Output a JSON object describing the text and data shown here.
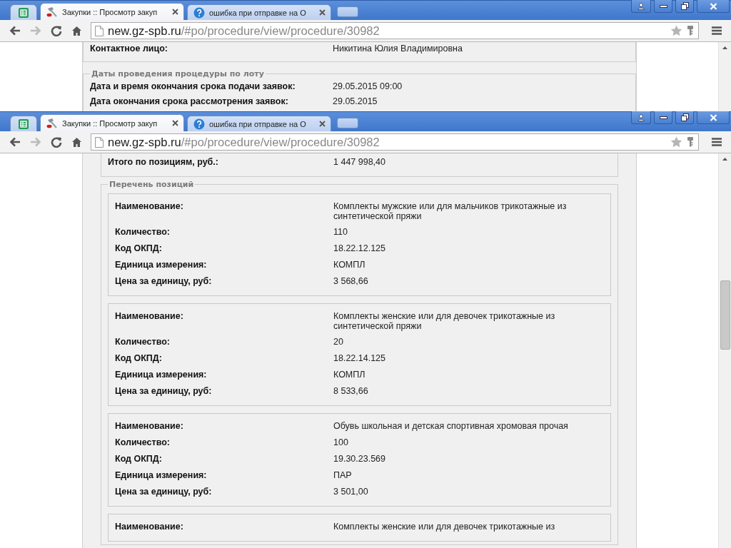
{
  "windows": [
    {
      "tabs": [
        {
          "kind": "app",
          "selected": false
        },
        {
          "kind": "page",
          "title": "Закупки :: Просмотр закуп",
          "selected": true
        },
        {
          "kind": "page",
          "title": "ошибка при отправке на О",
          "selected": false
        },
        {
          "kind": "new"
        }
      ],
      "address": {
        "host": "new.gz-spb.ru",
        "path": "/#po/procedure/view/procedure/30982"
      },
      "sections": [
        {
          "kind": "plain",
          "rows": [
            {
              "label": "Контактное лицо:",
              "value": "Никитина Юлия Владимировна"
            }
          ]
        },
        {
          "kind": "fieldset",
          "legend": "Даты проведения процедуры по лоту",
          "rows": [
            {
              "label": "Дата и время окончания срока подачи заявок:",
              "value": "29.05.2015 09:00"
            },
            {
              "label": "Дата окончания срока рассмотрения заявок:",
              "value": "29.05.2015"
            }
          ]
        }
      ]
    },
    {
      "tabs": [
        {
          "kind": "app",
          "selected": false
        },
        {
          "kind": "page",
          "title": "Закупки :: Просмотр закуп",
          "selected": true
        },
        {
          "kind": "page",
          "title": "ошибка при отправке на О",
          "selected": false
        },
        {
          "kind": "new"
        }
      ],
      "address": {
        "host": "new.gz-spb.ru",
        "path": "/#po/procedure/view/procedure/30982"
      },
      "sections": [
        {
          "kind": "plain",
          "rows": [
            {
              "label": "Итого по позициям, руб.:",
              "value": "1 447 998,40"
            }
          ]
        },
        {
          "kind": "fieldset",
          "legend": "Перечень позиций",
          "items": [
            {
              "rows": [
                {
                  "label": "Наименование:",
                  "value": "Комплекты мужские или для мальчиков трикотажные из синтетической пряжи"
                },
                {
                  "label": "Количество:",
                  "value": "110"
                },
                {
                  "label": "Код ОКПД:",
                  "value": "18.22.12.125"
                },
                {
                  "label": "Единица измерения:",
                  "value": "КОМПЛ"
                },
                {
                  "label": "Цена за единицу, руб:",
                  "value": "3 568,66"
                }
              ]
            },
            {
              "rows": [
                {
                  "label": "Наименование:",
                  "value": "Комплекты женские или для девочек трикотажные из синтетической пряжи"
                },
                {
                  "label": "Количество:",
                  "value": "20"
                },
                {
                  "label": "Код ОКПД:",
                  "value": "18.22.14.125"
                },
                {
                  "label": "Единица измерения:",
                  "value": "КОМПЛ"
                },
                {
                  "label": "Цена за единицу, руб:",
                  "value": "8 533,66"
                }
              ]
            },
            {
              "rows": [
                {
                  "label": "Наименование:",
                  "value": "Обувь школьная и детская спортивная хромовая прочая"
                },
                {
                  "label": "Количество:",
                  "value": "100"
                },
                {
                  "label": "Код ОКПД:",
                  "value": "19.30.23.569"
                },
                {
                  "label": "Единица измерения:",
                  "value": "ПАР"
                },
                {
                  "label": "Цена за единицу, руб:",
                  "value": "3 501,00"
                }
              ]
            },
            {
              "rows": [
                {
                  "label": "Наименование:",
                  "value": "Комплекты женские или для девочек трикотажные из"
                }
              ]
            }
          ]
        }
      ]
    }
  ]
}
